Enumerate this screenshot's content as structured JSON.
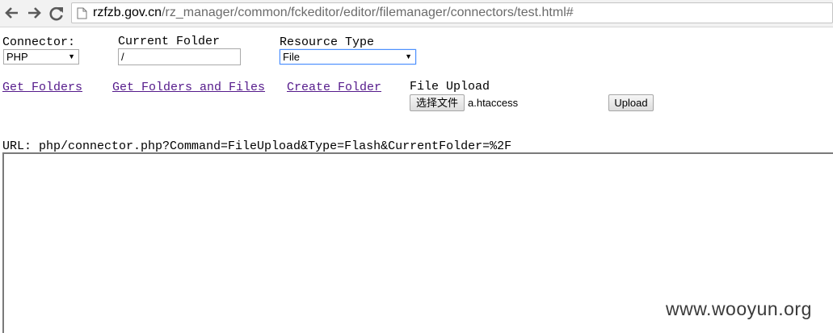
{
  "browser": {
    "url_host": "rzfzb.gov.cn",
    "url_path": "/rz_manager/common/fckeditor/editor/filemanager/connectors/test.html#",
    "icons": {
      "back": "back-arrow-icon",
      "forward": "forward-arrow-icon",
      "reload": "reload-icon",
      "page": "page-icon"
    }
  },
  "form": {
    "connector_label": "Connector:",
    "connector_value": "PHP",
    "current_folder_label": "Current Folder",
    "current_folder_value": "/",
    "resource_type_label": "Resource Type",
    "resource_type_value": "File"
  },
  "actions": {
    "get_folders": "Get Folders",
    "get_folders_and_files": "Get Folders and Files",
    "create_folder": "Create Folder"
  },
  "upload": {
    "label": "File Upload",
    "choose_button": "选择文件",
    "file_name": "a.htaccess",
    "upload_button": "Upload"
  },
  "url_line": "URL: php/connector.php?Command=FileUpload&Type=Flash&CurrentFolder=%2F",
  "watermark": "www.wooyun.org",
  "colors": {
    "visited_link": "#551a8b",
    "focus_border": "#4d90fe"
  }
}
